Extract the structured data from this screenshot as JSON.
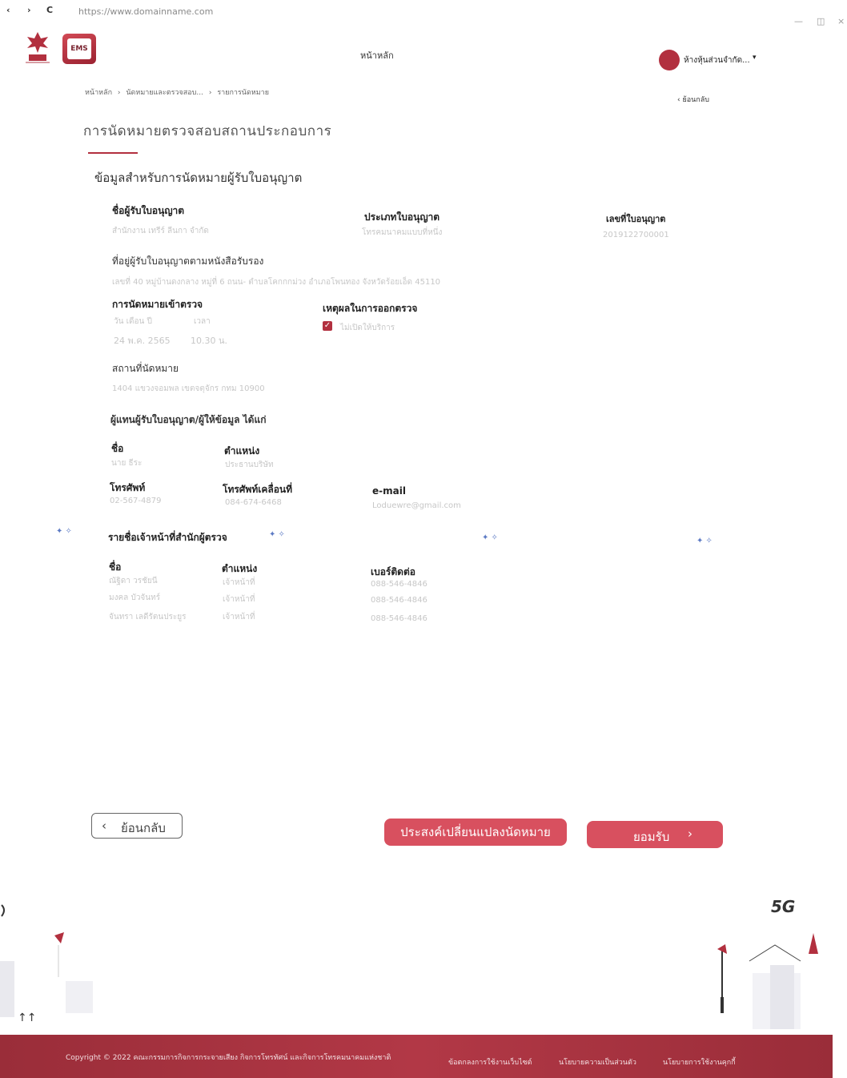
{
  "browser": {
    "back": "‹",
    "forward": "›",
    "reload": "C",
    "url": "https://www.domainname.com",
    "minimize": "—",
    "restore": "◫",
    "close": "×"
  },
  "header": {
    "ems_label": "EMS",
    "home_link": "หน้าหลัก",
    "user_name": "ห้างหุ้นส่วนจำกัด...",
    "user_caret": "▾"
  },
  "breadcrumb": {
    "items": [
      "หน้าหลัก",
      "›",
      "นัดหมายและตรวจสอบ...",
      "›",
      "รายการนัดหมาย"
    ]
  },
  "back_top": "‹  ย้อนกลับ",
  "page_title": "การนัดหมายตรวจสอบสถานประกอบการ",
  "section_title": "ข้อมูลสำหรับการนัดหมายผู้รับใบอนุญาต",
  "licensee": {
    "name_label": "ชื่อผู้รับใบอนุญาต",
    "name_value": "สำนักงาน เทรีร์ ลีนกา จำกัด",
    "type_label": "ประเภทใบอนุญาต",
    "type_value": "โทรคมนาคมแบบที่หนึ่ง",
    "number_label": "เลขที่ใบอนุญาต",
    "number_value": "2019122700001"
  },
  "address": {
    "label": "ที่อยู่ผู้รับใบอนุญาตตามหนังสือรับรอง",
    "value": "เลขที่ 40 หมู่บ้านดงกลาง หมู่ที่ 6 ถนน- ตำบลโคกกกม่วง อำเภอโพนทอง จังหวัดร้อยเอ็ด 45110"
  },
  "appointment": {
    "label": "การนัดหมายเข้าตรวจ",
    "day_label": "วัน เดือน ปี",
    "time_label": "เวลา",
    "date_value": "24 พ.ค. 2565",
    "time_value": "10.30 น."
  },
  "reason": {
    "label": "เหตุผลในการออกตรวจ",
    "check": "✓",
    "value": "ไม่เปิดให้บริการ"
  },
  "place": {
    "label": "สถานที่นัดหมาย",
    "value": "1404 แขวงจอมพล เขตจตุจักร กทม 10900"
  },
  "representative": {
    "title": "ผู้แทนผู้รับใบอนุญาต/ผู้ให้ข้อมูล ได้แก่",
    "name_label": "ชื่อ",
    "name_value": "นาย ธีระ",
    "position_label": "ตำแหน่ง",
    "position_value": "ประธานบริษัท",
    "phone_label": "โทรศัพท์",
    "phone_value": "02-567-4879",
    "mobile_label": "โทรศัพท์เคลื่อนที่",
    "mobile_value": "084-674-6468",
    "email_label": "e-mail",
    "email_value": "Loduewre@gmail.com"
  },
  "officers": {
    "title": "รายชื่อเจ้าหน้าที่สำนักผู้ตรวจ",
    "name_header": "ชื่อ",
    "position_header": "ตำแหน่ง",
    "contact_header": "เบอร์ติดต่อ",
    "rows": [
      {
        "name": "ณัฐิดา วรชัยนี",
        "position": "เจ้าหน้าที่",
        "phone": "088-546-4846"
      },
      {
        "name": "มงคล บัวจันทร์",
        "position": "เจ้าหน้าที่",
        "phone": "088-546-4846"
      },
      {
        "name": "จันทรา เลดีรัตนประยูร",
        "position": "เจ้าหน้าที่",
        "phone": "088-546-4846"
      }
    ]
  },
  "buttons": {
    "back_chevron": "‹",
    "back": "ย้อนกลับ",
    "change": "ประสงค์เปลี่ยนแปลงนัดหมาย",
    "accept": "ยอมรับ",
    "accept_chevron": "›"
  },
  "decoration": {
    "fiveg": "5G"
  },
  "footer": {
    "copyright": "Copyright © 2022 คณะกรรมการกิจการกระจายเสียง กิจการโทรทัศน์ และกิจการโทรคมนาคมแห่งชาติ",
    "links": [
      "ข้อตกลงการใช้งานเว็บไซต์",
      "นโยบายความเป็นส่วนตัว",
      "นโยบายการใช้งานคุกกี้"
    ]
  },
  "colors": {
    "brand": "#b2303f",
    "button": "#d8505f",
    "footer": "#a83340"
  }
}
